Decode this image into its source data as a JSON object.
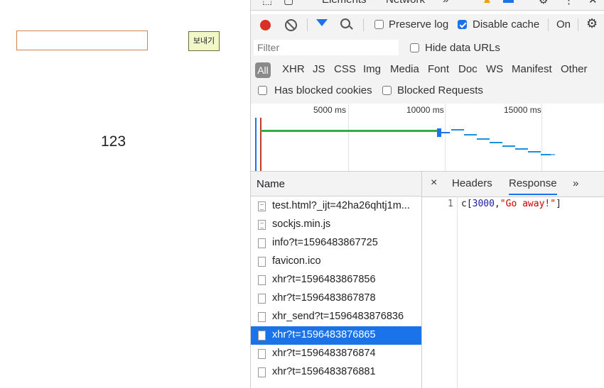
{
  "page": {
    "send_button": "보내기",
    "number": "123"
  },
  "devtools": {
    "top_tabs": [
      "Elements",
      "Network"
    ],
    "toolbar": {
      "preserve_log": "Preserve log",
      "disable_cache": "Disable cache",
      "online": "On"
    },
    "filter": {
      "placeholder": "Filter",
      "hide_data_urls": "Hide data URLs",
      "types": [
        "All",
        "XHR",
        "JS",
        "CSS",
        "Img",
        "Media",
        "Font",
        "Doc",
        "WS",
        "Manifest",
        "Other"
      ],
      "has_blocked_cookies": "Has blocked cookies",
      "blocked_requests": "Blocked Requests"
    },
    "timeline": {
      "ticks": [
        "5000 ms",
        "10000 ms",
        "15000 ms"
      ]
    },
    "requests": {
      "header": "Name",
      "rows": [
        "test.html?_ijt=42ha26qhtj1m...",
        "sockjs.min.js",
        "info?t=1596483867725",
        "favicon.ico",
        "xhr?t=1596483867856",
        "xhr?t=1596483867878",
        "xhr_send?t=1596483876836",
        "xhr?t=1596483876865",
        "xhr?t=1596483876874",
        "xhr?t=1596483876881"
      ],
      "selected_index": 7
    },
    "detail": {
      "close": "×",
      "tabs": [
        "Headers",
        "Response"
      ],
      "more": "»",
      "line_number": "1",
      "code_prefix": "c[",
      "code_number": "3000",
      "code_comma": ",",
      "code_string": "\"Go away!\"",
      "code_suffix": "]"
    },
    "colors": {
      "accent": "#1a73e8",
      "record": "#d93025",
      "code_number": "#1a1aa6",
      "code_string": "#c80000"
    }
  }
}
